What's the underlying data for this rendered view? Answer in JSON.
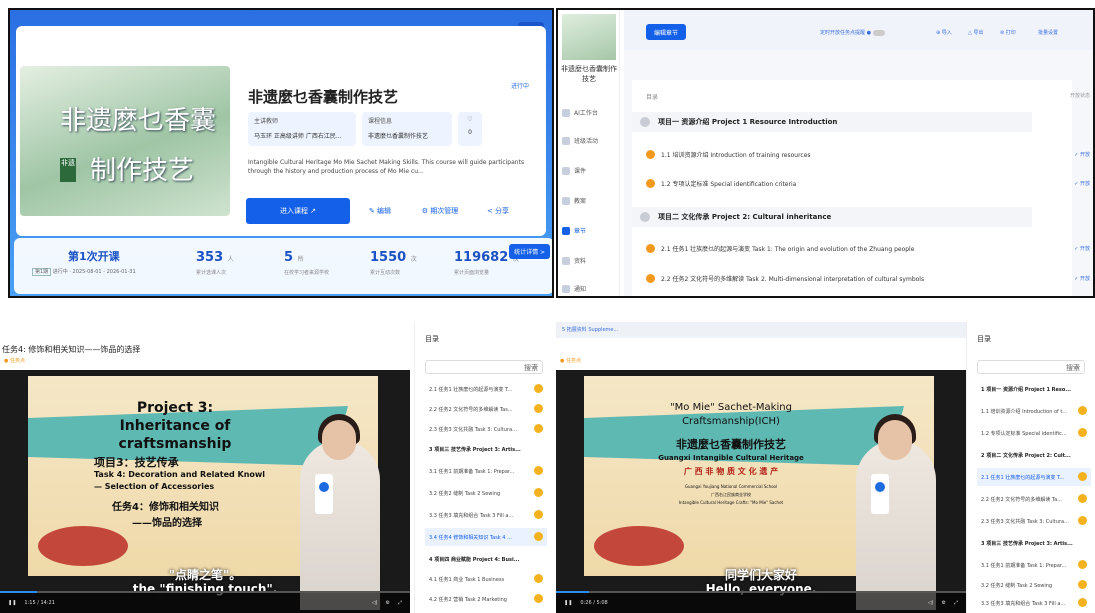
{
  "q1": {
    "cover_line1": "非遗麽乜香囊",
    "cover_line2": "制作技艺",
    "title": "非遗麼乜香囊制作技艺",
    "status": "进行中",
    "corner_badge": "回旧版",
    "teacher_label": "主讲教师",
    "teacher_value": "马玉环 正高级讲师 广西右江民...",
    "course_label": "课程信息",
    "course_value": "非遗麼乜香囊制作技艺",
    "like_icon": "heart",
    "like_label": "0",
    "desc": "Intangible Cultural Heritage Mo Mie Sachet Making Skills. This course will guide participants through the history and production process of Mo Mie cu...",
    "enter_btn": "进入课程 ↗",
    "edit_btn": "编辑",
    "manage_btn": "期次管理",
    "share_btn": "分享",
    "session_title": "第1次开课",
    "session_sel": "第1期",
    "session_dates": "进行中 · 2025-08-01 - 2026-01-31",
    "stats": [
      {
        "n": "353",
        "u": "人",
        "l": "累计选课人次"
      },
      {
        "n": "5",
        "u": "所",
        "l": "在校学习者来源学校"
      },
      {
        "n": "1550",
        "u": "次",
        "l": "累计互动次数"
      },
      {
        "n": "119682",
        "u": "次",
        "l": "累计页面浏览量"
      }
    ],
    "stats_badge": "统计详情 >"
  },
  "q2": {
    "course_title": "非遗麼乜香囊制作技艺",
    "nav": [
      "AI工作台",
      "班级活动",
      "课件",
      "教案",
      "章节",
      "资料",
      "通知"
    ],
    "edit_btn": "编辑章节",
    "toolbar": [
      "定时开放任务点提醒",
      "导入",
      "导出",
      "打印",
      "批量设置"
    ],
    "col_head": "目录",
    "col_status": "开放状态",
    "rows": [
      {
        "type": "proj",
        "text": "项目一 资源介绍 Project 1 Resource Introduction"
      },
      {
        "type": "task",
        "text": "1.1 培训资源介绍 Introduction of training resources",
        "st": "✓ 开放"
      },
      {
        "type": "task",
        "text": "1.2 专项认定标准 Special identification criteria",
        "st": "✓ 开放"
      },
      {
        "type": "proj",
        "text": "项目二 文化传承 Project 2: Cultural inheritance"
      },
      {
        "type": "task",
        "text": "2.1 任务1 壮族麽乜的起源与演变 Task 1: The origin and evolution of the Zhuang people",
        "st": "✓ 开放"
      },
      {
        "type": "task",
        "text": "2.2 任务2 文化符号的多维解读 Task 2. Multi-dimensional interpretation of cultural symbols",
        "st": "✓ 开放"
      }
    ]
  },
  "q3": {
    "title": "任务4: 修饰和相关知识——饰品的选择",
    "task_tag": "● 任务点",
    "slide_en1": "Project 3:",
    "slide_en2": "Inheritance of",
    "slide_en3": "craftsmanship",
    "slide_cn1": "项目3：技艺传承",
    "slide_en4": "Task 4: Decoration and Related Knowl",
    "slide_en5": "— Selection of Accessories",
    "slide_cn2": "任务4：修饰和相关知识",
    "slide_cn3": "——饰品的选择",
    "sub_cn": "\"点睛之笔\"。",
    "sub_en": "the \"finishing touch\".",
    "time": "1:15 / 14:21",
    "side_head": "目录",
    "search": "搜索",
    "items": [
      {
        "t": "2.1 任务1 壮族麽乜的起源与演变 T...",
        "c": ""
      },
      {
        "t": "2.2 任务2 文化符号的多维解读 Tas...",
        "c": ""
      },
      {
        "t": "2.3 任务3 文化共融 Task 3: Cultura...",
        "c": ""
      },
      {
        "t": "3 项目三 技艺传承 Project 3: Artis...",
        "c": "hd"
      },
      {
        "t": "3.1 任务1 前期准备 Task 1: Prepar...",
        "c": ""
      },
      {
        "t": "3.2 任务2 缝制 Task 2 Sewing",
        "c": ""
      },
      {
        "t": "3.3 任务3 填充和组合 Task 3 Fill a...",
        "c": ""
      },
      {
        "t": "3.4 任务4 修饰和相关知识 Task 4 ...",
        "c": "act"
      },
      {
        "t": "4 项目四 商业赋能 Project 4: Busi...",
        "c": "hd"
      },
      {
        "t": "4.1 任务1 商业 Task 1 Business",
        "c": ""
      },
      {
        "t": "4.2 任务2 营销 Task 2 Marketing",
        "c": ""
      }
    ]
  },
  "q4": {
    "breadcrumb": "5 拓展资料 Suppleme...",
    "task_tag": "● 任务点",
    "slide_en1": "\"Mo Mie\" Sachet-Making",
    "slide_en2": "Craftsmanship(ICH)",
    "slide_cn1": "非遗麼乜香囊制作技艺",
    "slide_en3": "Guangxi Intangible Cultural Heritage",
    "slide_cn2": "广 西 非 物 质 文 化 遗 产",
    "slide_small1": "Guangxi Youjiang National Commercial School",
    "slide_small2": "广西右江民族商业学校",
    "slide_small3": "Intangible Cultural Heritage Crafts: \"Mo Mie\" Sachet",
    "sub_cn": "同学们大家好",
    "sub_en": "Hello, everyone.",
    "time": "0:26 / 5:08",
    "side_head": "目录",
    "search": "搜索",
    "items": [
      {
        "t": "1 项目一 资源介绍 Project 1 Reso...",
        "c": "hd"
      },
      {
        "t": "1.1 培训资源介绍 Introduction of t...",
        "c": ""
      },
      {
        "t": "1.2 专项认定标准 Special identific...",
        "c": ""
      },
      {
        "t": "2 项目二 文化传承 Project 2: Cult...",
        "c": "hd"
      },
      {
        "t": "2.1 任务1 壮族麽乜的起源与演变 T...",
        "c": "act"
      },
      {
        "t": "2.2 任务2 文化符号的多维解读 Ta...",
        "c": ""
      },
      {
        "t": "2.3 任务3 文化共融 Task 3: Cultura...",
        "c": ""
      },
      {
        "t": "3 项目三 技艺传承 Project 3: Artis...",
        "c": "hd"
      },
      {
        "t": "3.1 任务1 前期准备 Task 1: Prepar...",
        "c": ""
      },
      {
        "t": "3.2 任务2 缝制 Task 2 Sewing",
        "c": ""
      },
      {
        "t": "3.3 任务3 填充和组合 Task 3 Fill a...",
        "c": ""
      }
    ]
  }
}
